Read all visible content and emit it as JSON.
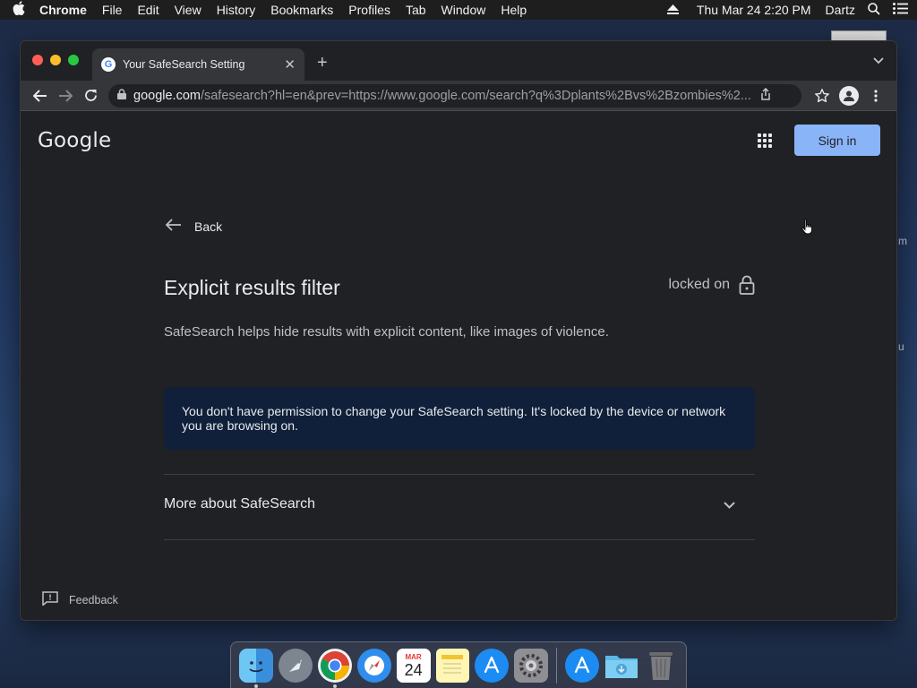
{
  "menubar": {
    "app_name": "Chrome",
    "items": [
      "File",
      "Edit",
      "View",
      "History",
      "Bookmarks",
      "Profiles",
      "Tab",
      "Window",
      "Help"
    ],
    "datetime": "Thu Mar 24  2:20 PM",
    "user": "Dartz"
  },
  "desktop": {
    "frag1": "m",
    "frag2": "u"
  },
  "browser": {
    "tab_title": "Your SafeSearch Setting",
    "url_host": "google.com",
    "url_path": "/safesearch?hl=en&prev=https://www.google.com/search?q%3Dplants%2Bvs%2Bzombies%2..."
  },
  "page": {
    "logo": "Google",
    "sign_in_label": "Sign in",
    "back_label": "Back",
    "heading": "Explicit results filter",
    "locked_label": "locked on",
    "description": "SafeSearch helps hide results with explicit content, like images of violence.",
    "notice": "You don't have permission to change your SafeSearch setting. It's locked by the device or network you are browsing on.",
    "more_label": "More about SafeSearch",
    "feedback_label": "Feedback"
  },
  "dock": {
    "apps": [
      "finder",
      "launchpad",
      "chrome",
      "safari",
      "calendar",
      "notes",
      "app-store",
      "system-preferences",
      "app-store-2",
      "downloads-folder",
      "trash"
    ],
    "calendar_month": "MAR",
    "calendar_day": "24"
  },
  "colors": {
    "accent": "#8ab4f8",
    "page_bg": "#202124",
    "notice_bg": "#10203a"
  }
}
